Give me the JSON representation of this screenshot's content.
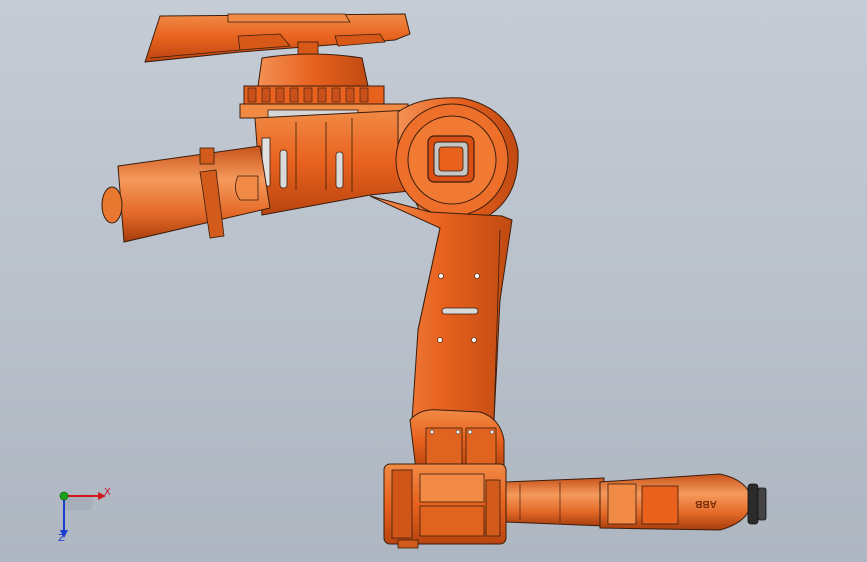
{
  "viewport": {
    "background_top": "#c5ccd6",
    "background_bottom": "#aeb6c1",
    "model_color": "#e8621e",
    "model_shadow": "#b9440f",
    "model_highlight": "#f5924f",
    "edge_color": "#3a1e0e"
  },
  "model": {
    "brand_label": "ABB"
  },
  "triad": {
    "x_label": "X",
    "y_label": "",
    "z_label": "Z",
    "x_color": "#d01818",
    "y_color": "#1aa31a",
    "z_color": "#1a3ccf"
  }
}
